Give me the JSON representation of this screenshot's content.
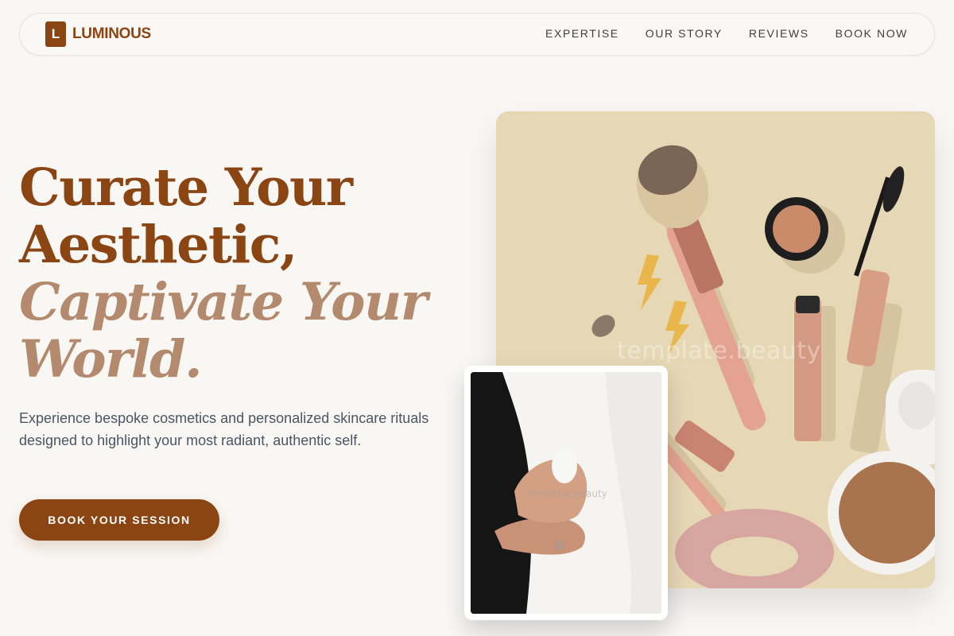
{
  "brand": {
    "logo_letter": "L",
    "name": "LUMINOUS",
    "color": "#8b4513"
  },
  "nav": {
    "links": [
      {
        "label": "EXPERTISE"
      },
      {
        "label": "OUR STORY"
      },
      {
        "label": "REVIEWS"
      },
      {
        "label": "BOOK NOW"
      }
    ]
  },
  "hero": {
    "title_line1": "Curate Your",
    "title_line2": "Aesthetic,",
    "title_accent1": "Captivate Your",
    "title_accent2": "World.",
    "accent_color": "#b38a6d",
    "subtitle": "Experience bespoke cosmetics and personalized skincare rituals designed to highlight your most radiant, authentic self.",
    "cta_label": "BOOK YOUR SESSION"
  },
  "images": {
    "main_watermark": "template.beauty",
    "card_watermark": "template.beauty"
  }
}
